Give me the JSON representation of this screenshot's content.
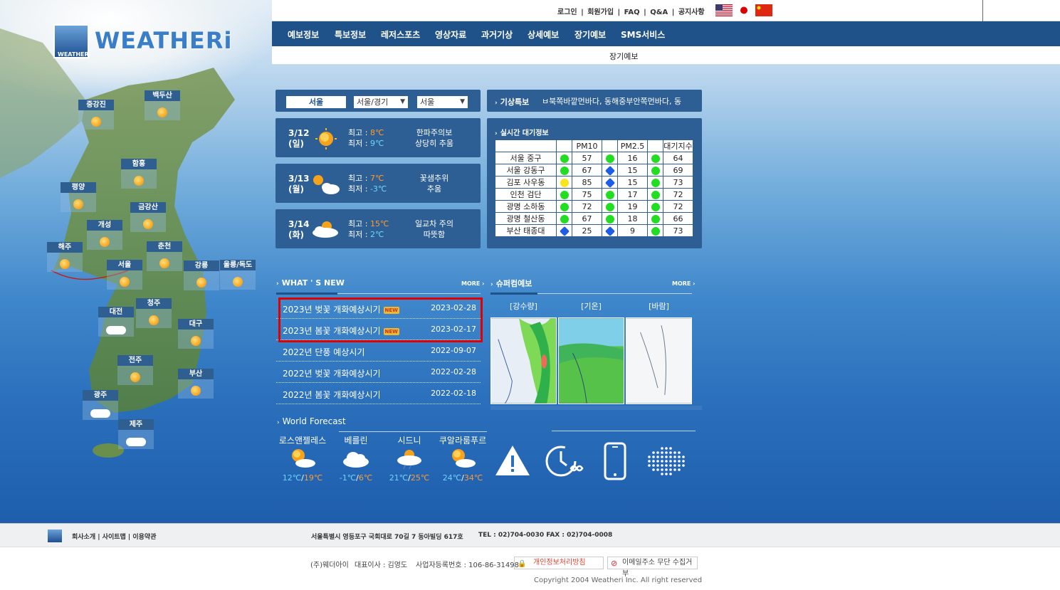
{
  "header": {
    "logo_text": "WEATHERi",
    "logo_small": "WEATHERi",
    "top_links": [
      "로그인",
      "회원가입",
      "FAQ",
      "Q&A",
      "공지사항"
    ],
    "top_sep": "|"
  },
  "nav": {
    "items": [
      "예보정보",
      "특보정보",
      "레저스포츠",
      "영상자료",
      "과거기상",
      "상세예보",
      "장기예보",
      "SMS서비스"
    ],
    "current_sub": "장기예보"
  },
  "map": {
    "cities": [
      "중강진",
      "백두산",
      "함흥",
      "평양",
      "금강산",
      "개성",
      "해주",
      "춘천",
      "서울",
      "강릉",
      "울릉/독도",
      "청주",
      "대전",
      "대구",
      "전주",
      "부산",
      "광주",
      "제주"
    ]
  },
  "location": {
    "current": "서울",
    "region_select": "서울/경기",
    "city_select": "서울"
  },
  "forecast": [
    {
      "date": "3/12",
      "day": "(일)",
      "hi_label": "최고 : ",
      "hi": "8℃",
      "lo_label": "최저 : ",
      "lo": "9℃",
      "note1": "한파주의보",
      "note2": "상당히 추움",
      "icon": "sun-icon"
    },
    {
      "date": "3/13",
      "day": "(월)",
      "hi_label": "최고 : ",
      "hi": "7℃",
      "lo_label": "최저 : ",
      "lo": "-3℃",
      "note1": "꽃샘추위",
      "note2": "추움",
      "icon": "sun-cloud-icon"
    },
    {
      "date": "3/14",
      "day": "(화)",
      "hi_label": "최고 : ",
      "hi": "15℃",
      "lo_label": "최저 : ",
      "lo": "2℃",
      "note1": "일교차 주의",
      "note2": "따뜻함",
      "icon": "cloud-sun-icon"
    }
  ],
  "warning": {
    "label": "기상특보",
    "text": "ㅂ북쪽바깥먼바다, 동해중부안쪽먼바다, 동"
  },
  "air_quality": {
    "title": "실시간 대기정보",
    "headers": [
      "",
      "PM10",
      "PM2.5",
      "대기지수"
    ],
    "rows": [
      {
        "name": "서울 중구",
        "pm10_level": "g",
        "pm10": "57",
        "pm25_level": "g",
        "pm25": "16",
        "aqi_level": "g",
        "aqi": "64"
      },
      {
        "name": "서울 강동구",
        "pm10_level": "g",
        "pm10": "67",
        "pm25_level": "b",
        "pm25": "15",
        "aqi_level": "g",
        "aqi": "69"
      },
      {
        "name": "김포 사우동",
        "pm10_level": "y",
        "pm10": "85",
        "pm25_level": "b",
        "pm25": "15",
        "aqi_level": "g",
        "aqi": "73"
      },
      {
        "name": "인천 검단",
        "pm10_level": "g",
        "pm10": "75",
        "pm25_level": "g",
        "pm25": "17",
        "aqi_level": "g",
        "aqi": "72"
      },
      {
        "name": "광명 소하동",
        "pm10_level": "g",
        "pm10": "72",
        "pm25_level": "g",
        "pm25": "19",
        "aqi_level": "g",
        "aqi": "72"
      },
      {
        "name": "광명 철산동",
        "pm10_level": "g",
        "pm10": "67",
        "pm25_level": "g",
        "pm25": "18",
        "aqi_level": "g",
        "aqi": "66"
      },
      {
        "name": "부산 태종대",
        "pm10_level": "b",
        "pm10": "25",
        "pm25_level": "b",
        "pm25": "9",
        "aqi_level": "g",
        "aqi": "73"
      }
    ]
  },
  "whats_new": {
    "title": "WHAT ' S NEW",
    "more": "MORE ›",
    "new_badge": "NEW",
    "items": [
      {
        "title": "2023년 벚꽃 개화예상시기",
        "date": "2023-02-28",
        "is_new": true
      },
      {
        "title": "2023년 봄꽃 개화예상시기",
        "date": "2023-02-17",
        "is_new": true
      },
      {
        "title": "2022년 단풍 예상시기",
        "date": "2022-09-07",
        "is_new": false
      },
      {
        "title": "2022년 벚꽃 개화예상시기",
        "date": "2022-02-28",
        "is_new": false
      },
      {
        "title": "2022년 봄꽃 개화예상시기",
        "date": "2022-02-18",
        "is_new": false
      }
    ]
  },
  "supercom": {
    "title": "슈퍼컴예보",
    "more": "MORE ›",
    "labels": [
      "[강수량]",
      "[기온]",
      "[바람]"
    ]
  },
  "world": {
    "title": "World Forecast",
    "cities": [
      {
        "name": "로스앤젤레스",
        "lo": "12℃",
        "hi": "19℃",
        "icon": "sun-cloud-icon"
      },
      {
        "name": "베를린",
        "lo": "-1℃",
        "hi": "6℃",
        "icon": "cloud-icon"
      },
      {
        "name": "시드니",
        "lo": "21℃",
        "hi": "25℃",
        "icon": "sun-rain-icon"
      },
      {
        "name": "쿠알라룸푸르",
        "lo": "24℃",
        "hi": "34℃",
        "icon": "sun-cloud-icon"
      }
    ],
    "sep": "/"
  },
  "footer": {
    "links": "회사소개 | 사이트맵 | 이용약관",
    "address": "서울특별시 영등포구 국회대로 70길 7 동아빌딩 617호",
    "tel": "TEL : 02)704-0030 FAX : 02)704-0008",
    "company": "(주)웨더아이",
    "ceo": "대표이사 : 김영도",
    "biz_no": "사업자등록번호 : 106-86-31498",
    "privacy": "개인정보처리방침",
    "email_policy": "이메일주소 무단 수집거부",
    "copyright": "Copyright 2004 Weatheri Inc. All right reserved"
  },
  "colors": {
    "nav_bg": "#1f5288",
    "panel_bg": "#2d5f94",
    "hi_temp": "#ff9a30",
    "lo_temp": "#6cd6ff",
    "highlight": "#e00000"
  }
}
